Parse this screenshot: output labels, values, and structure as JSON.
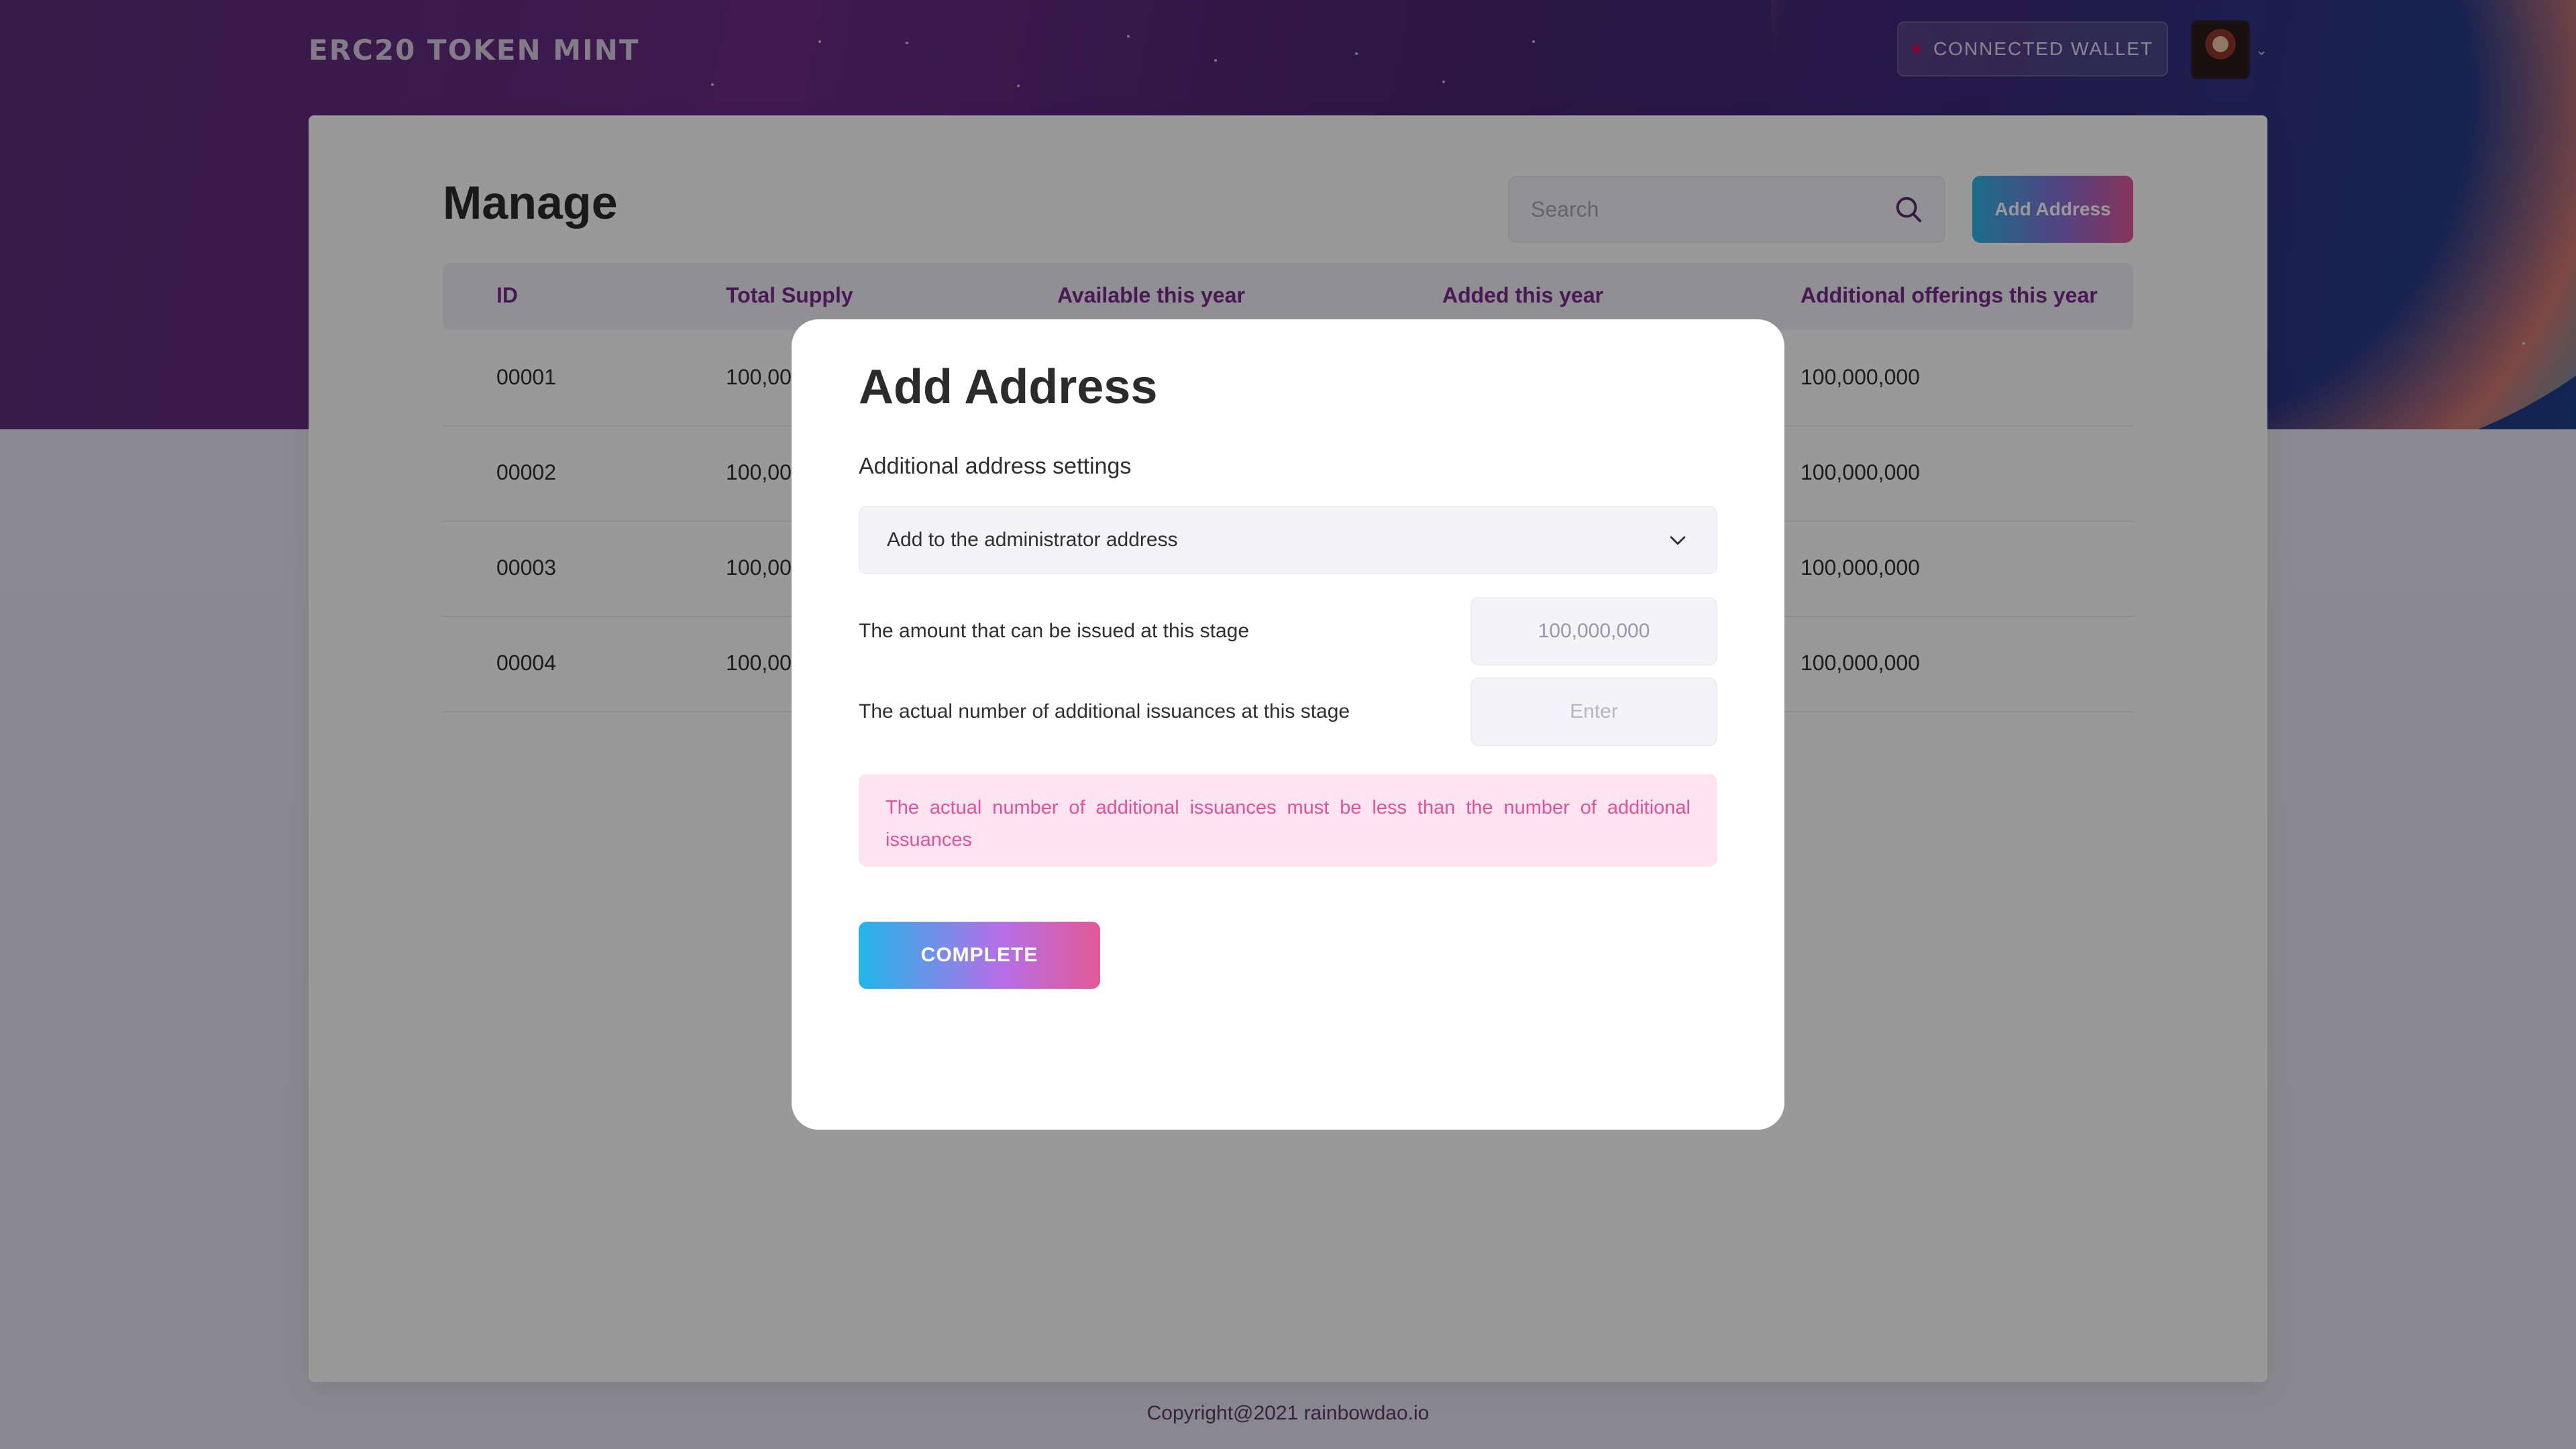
{
  "header": {
    "brand": "ERC20 TOKEN MINT",
    "wallet_label": "CONNECTED  WALLET"
  },
  "page": {
    "title": "Manage",
    "search_placeholder": "Search",
    "add_button": "Add Address"
  },
  "table": {
    "columns": [
      "ID",
      "Total Supply",
      "Available this year",
      "Added this year",
      "Additional offerings this year"
    ],
    "rows": [
      {
        "id": "00001",
        "total_supply": "100,00",
        "additional": "100,000,000"
      },
      {
        "id": "00002",
        "total_supply": "100,00",
        "additional": "100,000,000"
      },
      {
        "id": "00003",
        "total_supply": "100,00",
        "additional": "100,000,000"
      },
      {
        "id": "00004",
        "total_supply": "100,00",
        "additional": "100,000,000"
      }
    ]
  },
  "modal": {
    "title": "Add Address",
    "subtitle": "Additional address settings",
    "select_value": "Add to the administrator address",
    "amount_label": "The amount that can be issued at this stage",
    "amount_value": "100,000,000",
    "actual_label": "The actual number of additional issuances at this stage",
    "actual_placeholder": "Enter",
    "error": "The actual number of additional issuances must be less than the number of additional issuances",
    "complete_button": "COMPLETE"
  },
  "footer": {
    "copyright": "Copyright@2021 rainbowdao.io"
  },
  "colors": {
    "accent_purple": "#7a2a8a",
    "error_pink": "#e2529a",
    "gradient_start": "#22b6ea",
    "gradient_end": "#e25a96"
  }
}
